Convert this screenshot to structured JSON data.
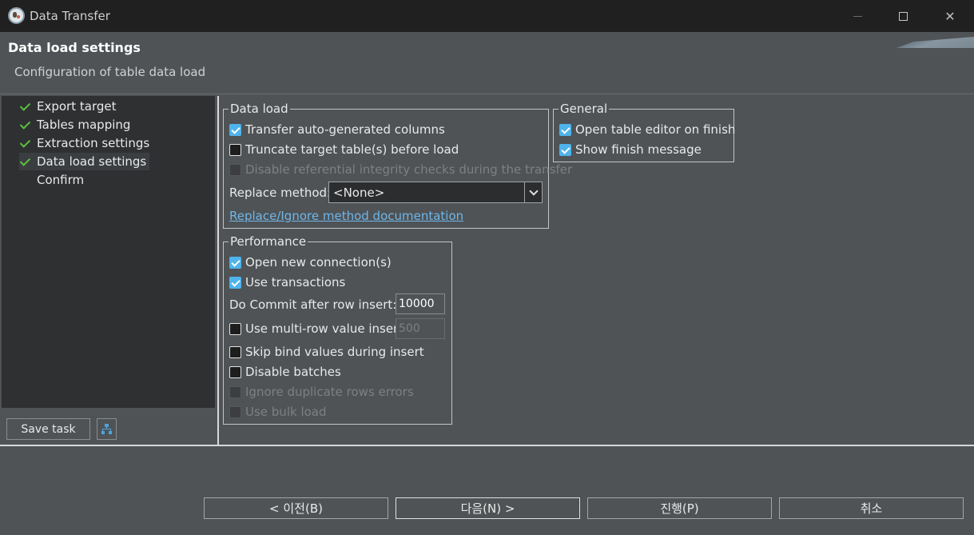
{
  "window": {
    "title": "Data Transfer"
  },
  "header": {
    "title": "Data load settings",
    "subtitle": "Configuration of table data load"
  },
  "nav": {
    "items": [
      {
        "label": "Export target",
        "done": true
      },
      {
        "label": "Tables mapping",
        "done": true
      },
      {
        "label": "Extraction settings",
        "done": true
      },
      {
        "label": "Data load settings",
        "done": true,
        "active": true
      },
      {
        "label": "Confirm",
        "done": false
      }
    ],
    "save_task_label": "Save task"
  },
  "data_load": {
    "legend": "Data load",
    "transfer_auto_generated": {
      "label": "Transfer auto-generated columns",
      "checked": true
    },
    "truncate_target": {
      "label": "Truncate target table(s) before load",
      "checked": false
    },
    "disable_ref_integrity": {
      "label": "Disable referential integrity checks during the transfer",
      "checked": false,
      "disabled": true
    },
    "replace_method_label": "Replace method:",
    "replace_method_value": "<None>",
    "doc_link": "Replace/Ignore method documentation"
  },
  "general": {
    "legend": "General",
    "open_editor": {
      "label": "Open table editor on finish",
      "checked": true
    },
    "show_finish": {
      "label": "Show finish message",
      "checked": true
    }
  },
  "performance": {
    "legend": "Performance",
    "open_new_connection": {
      "label": "Open new connection(s)",
      "checked": true
    },
    "use_transactions": {
      "label": "Use transactions",
      "checked": true
    },
    "commit_label": "Do Commit after row insert:",
    "commit_value": "10000",
    "multi_row": {
      "label": "Use multi-row value insert",
      "checked": false
    },
    "multi_row_value": "500",
    "skip_bind": {
      "label": "Skip bind values during insert",
      "checked": false
    },
    "disable_batches": {
      "label": "Disable batches",
      "checked": false
    },
    "ignore_duplicates": {
      "label": "Ignore duplicate rows errors",
      "checked": false,
      "disabled": true
    },
    "use_bulk_load": {
      "label": "Use bulk load",
      "checked": false,
      "disabled": true
    }
  },
  "footer": {
    "back_label": "< 이전(B)",
    "next_label": "다음(N) >",
    "proceed_label": "진행(P)",
    "cancel_label": "취소"
  },
  "colors": {
    "accent_check": "#4fb3ec",
    "nav_check": "#5bbf3f",
    "link": "#6fb6e8",
    "background": "#4f5356"
  }
}
